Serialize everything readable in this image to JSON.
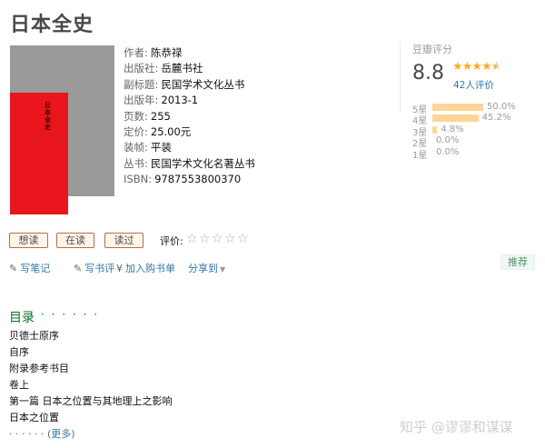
{
  "book": {
    "title": "日本全史"
  },
  "cover": {
    "band_color": "#e8161c",
    "background_color": "#9a9a9a",
    "vertical_title": "日本全史"
  },
  "info": [
    {
      "label": "作者:",
      "value": "陈恭禄",
      "link": true
    },
    {
      "label": "出版社:",
      "value": "岳麓书社",
      "link": false
    },
    {
      "label": "副标题:",
      "value": "民国学术文化丛书",
      "link": false
    },
    {
      "label": "出版年:",
      "value": "2013-1",
      "link": false
    },
    {
      "label": "页数:",
      "value": "255",
      "link": false
    },
    {
      "label": "定价:",
      "value": "25.00元",
      "link": false
    },
    {
      "label": "装帧:",
      "value": "平装",
      "link": false
    },
    {
      "label": "丛书:",
      "value": "民国学术文化名著丛书",
      "link": true
    },
    {
      "label": "ISBN:",
      "value": "9787553800370",
      "link": false
    }
  ],
  "rating": {
    "header": "豆瓣评分",
    "score": "8.8",
    "stars": 4.5,
    "count": "42人评价",
    "distribution": [
      {
        "star": "5星",
        "percent": "50.0%",
        "value": 50.0
      },
      {
        "star": "4星",
        "percent": "45.2%",
        "value": 45.2
      },
      {
        "star": "3星",
        "percent": "4.8%",
        "value": 4.8
      },
      {
        "star": "2星",
        "percent": "0.0%",
        "value": 0.0
      },
      {
        "star": "1星",
        "percent": "0.0%",
        "value": 0.0
      }
    ]
  },
  "actions": {
    "want": "想读",
    "reading": "在读",
    "read": "读过",
    "rate_label": "评价:"
  },
  "links": {
    "note": "写笔记",
    "review": "写书评",
    "cart": "加入购书单",
    "share": "分享到",
    "recommend": "推荐"
  },
  "toc": {
    "title": "目录",
    "dots": "· · · · · ·",
    "items": [
      "贝德士原序",
      "自序",
      "附录参考书目",
      "卷上",
      "第一篇 日本之位置与其地理上之影响",
      "日本之位置"
    ],
    "more_prefix": "· · · · · · (",
    "more_link": "更多",
    "more_suffix": ")"
  },
  "watermark": "知乎 @谬谬和谋谋",
  "colors": {
    "link": "#3377aa",
    "green": "#007722",
    "star": "#ffac2d",
    "bar": "#ffd596"
  }
}
